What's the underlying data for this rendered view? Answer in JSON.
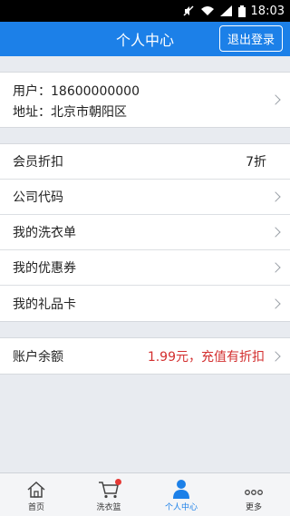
{
  "status_bar": {
    "time": "18:03"
  },
  "header": {
    "title": "个人中心",
    "logout_label": "退出登录"
  },
  "user": {
    "phone_line": "用户：18600000000",
    "address_line": "地址：北京市朝阳区"
  },
  "menu": [
    {
      "label": "会员折扣",
      "value": "7折",
      "has_chevron": false
    },
    {
      "label": "公司代码",
      "has_chevron": true
    },
    {
      "label": "我的洗衣单",
      "has_chevron": true
    },
    {
      "label": "我的优惠券",
      "has_chevron": true
    },
    {
      "label": "我的礼品卡",
      "has_chevron": true
    }
  ],
  "balance": {
    "label": "账户余额",
    "value": "1.99元，充值有折扣"
  },
  "tabs": [
    {
      "label": "首页",
      "icon": "home-icon"
    },
    {
      "label": "洗衣篮",
      "icon": "cart-icon",
      "badge": true
    },
    {
      "label": "个人中心",
      "icon": "person-icon",
      "active": true
    },
    {
      "label": "更多",
      "icon": "more-icon"
    }
  ],
  "colors": {
    "accent": "#1c80e8",
    "price_red": "#d32f2f",
    "badge_red": "#e53935"
  }
}
